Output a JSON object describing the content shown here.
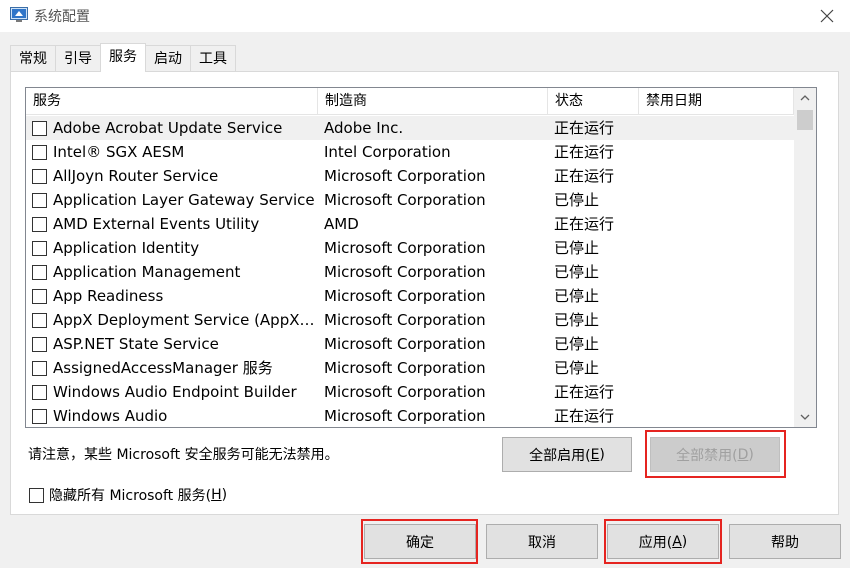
{
  "window": {
    "title": "系统配置"
  },
  "tabs": [
    "常规",
    "引导",
    "服务",
    "启动",
    "工具"
  ],
  "active_tab": 2,
  "columns": {
    "service": "服务",
    "manufacturer": "制造商",
    "status": "状态",
    "disabled_date": "禁用日期"
  },
  "services": [
    {
      "name": "Adobe Acrobat Update Service",
      "manufacturer": "Adobe Inc.",
      "status": "正在运行",
      "date": ""
    },
    {
      "name": "Intel® SGX AESM",
      "manufacturer": "Intel Corporation",
      "status": "正在运行",
      "date": ""
    },
    {
      "name": "AllJoyn Router Service",
      "manufacturer": "Microsoft Corporation",
      "status": "正在运行",
      "date": ""
    },
    {
      "name": "Application Layer Gateway Service",
      "manufacturer": "Microsoft Corporation",
      "status": "已停止",
      "date": ""
    },
    {
      "name": "AMD External Events Utility",
      "manufacturer": "AMD",
      "status": "正在运行",
      "date": ""
    },
    {
      "name": "Application Identity",
      "manufacturer": "Microsoft Corporation",
      "status": "已停止",
      "date": ""
    },
    {
      "name": "Application Management",
      "manufacturer": "Microsoft Corporation",
      "status": "已停止",
      "date": ""
    },
    {
      "name": "App Readiness",
      "manufacturer": "Microsoft Corporation",
      "status": "已停止",
      "date": ""
    },
    {
      "name": "AppX Deployment Service (AppXS...",
      "manufacturer": "Microsoft Corporation",
      "status": "已停止",
      "date": ""
    },
    {
      "name": "ASP.NET State Service",
      "manufacturer": "Microsoft Corporation",
      "status": "已停止",
      "date": ""
    },
    {
      "name": "AssignedAccessManager 服务",
      "manufacturer": "Microsoft Corporation",
      "status": "已停止",
      "date": ""
    },
    {
      "name": "Windows Audio Endpoint Builder",
      "manufacturer": "Microsoft Corporation",
      "status": "正在运行",
      "date": ""
    },
    {
      "name": "Windows Audio",
      "manufacturer": "Microsoft Corporation",
      "status": "正在运行",
      "date": ""
    }
  ],
  "note": "请注意，某些 Microsoft 安全服务可能无法禁用。",
  "enable_all": {
    "label": "全部启用(",
    "key": "E",
    "tail": ")"
  },
  "disable_all": {
    "label": "全部禁用(",
    "key": "D",
    "tail": ")"
  },
  "hide_ms": {
    "label": "隐藏所有 Microsoft 服务(",
    "key": "H",
    "tail": ")",
    "checked": false
  },
  "buttons": {
    "ok": "确定",
    "cancel": "取消",
    "apply": {
      "label": "应用(",
      "key": "A",
      "tail": ")"
    },
    "help": "帮助"
  },
  "colors": {
    "highlight_box": "#e52420",
    "panel_bg": "#ffffff",
    "dialog_bg": "#f0f0f0"
  },
  "icons": [
    "msconfig-app-icon",
    "close-icon",
    "scroll-up-arrow-icon",
    "scroll-down-arrow-icon",
    "checkbox-icon"
  ]
}
